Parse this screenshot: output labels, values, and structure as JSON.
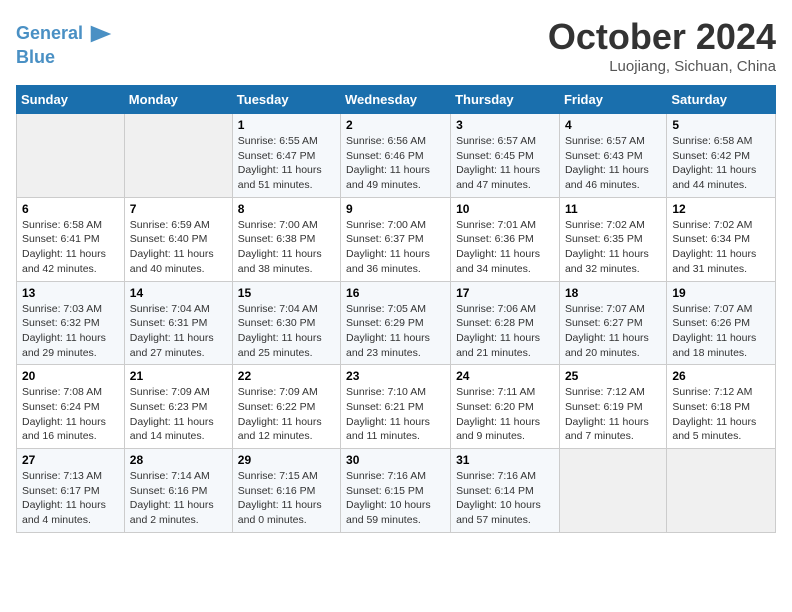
{
  "header": {
    "logo_line1": "General",
    "logo_line2": "Blue",
    "month_title": "October 2024",
    "subtitle": "Luojiang, Sichuan, China"
  },
  "days_of_week": [
    "Sunday",
    "Monday",
    "Tuesday",
    "Wednesday",
    "Thursday",
    "Friday",
    "Saturday"
  ],
  "weeks": [
    [
      {
        "day": "",
        "info": ""
      },
      {
        "day": "",
        "info": ""
      },
      {
        "day": "1",
        "info": "Sunrise: 6:55 AM\nSunset: 6:47 PM\nDaylight: 11 hours and 51 minutes."
      },
      {
        "day": "2",
        "info": "Sunrise: 6:56 AM\nSunset: 6:46 PM\nDaylight: 11 hours and 49 minutes."
      },
      {
        "day": "3",
        "info": "Sunrise: 6:57 AM\nSunset: 6:45 PM\nDaylight: 11 hours and 47 minutes."
      },
      {
        "day": "4",
        "info": "Sunrise: 6:57 AM\nSunset: 6:43 PM\nDaylight: 11 hours and 46 minutes."
      },
      {
        "day": "5",
        "info": "Sunrise: 6:58 AM\nSunset: 6:42 PM\nDaylight: 11 hours and 44 minutes."
      }
    ],
    [
      {
        "day": "6",
        "info": "Sunrise: 6:58 AM\nSunset: 6:41 PM\nDaylight: 11 hours and 42 minutes."
      },
      {
        "day": "7",
        "info": "Sunrise: 6:59 AM\nSunset: 6:40 PM\nDaylight: 11 hours and 40 minutes."
      },
      {
        "day": "8",
        "info": "Sunrise: 7:00 AM\nSunset: 6:38 PM\nDaylight: 11 hours and 38 minutes."
      },
      {
        "day": "9",
        "info": "Sunrise: 7:00 AM\nSunset: 6:37 PM\nDaylight: 11 hours and 36 minutes."
      },
      {
        "day": "10",
        "info": "Sunrise: 7:01 AM\nSunset: 6:36 PM\nDaylight: 11 hours and 34 minutes."
      },
      {
        "day": "11",
        "info": "Sunrise: 7:02 AM\nSunset: 6:35 PM\nDaylight: 11 hours and 32 minutes."
      },
      {
        "day": "12",
        "info": "Sunrise: 7:02 AM\nSunset: 6:34 PM\nDaylight: 11 hours and 31 minutes."
      }
    ],
    [
      {
        "day": "13",
        "info": "Sunrise: 7:03 AM\nSunset: 6:32 PM\nDaylight: 11 hours and 29 minutes."
      },
      {
        "day": "14",
        "info": "Sunrise: 7:04 AM\nSunset: 6:31 PM\nDaylight: 11 hours and 27 minutes."
      },
      {
        "day": "15",
        "info": "Sunrise: 7:04 AM\nSunset: 6:30 PM\nDaylight: 11 hours and 25 minutes."
      },
      {
        "day": "16",
        "info": "Sunrise: 7:05 AM\nSunset: 6:29 PM\nDaylight: 11 hours and 23 minutes."
      },
      {
        "day": "17",
        "info": "Sunrise: 7:06 AM\nSunset: 6:28 PM\nDaylight: 11 hours and 21 minutes."
      },
      {
        "day": "18",
        "info": "Sunrise: 7:07 AM\nSunset: 6:27 PM\nDaylight: 11 hours and 20 minutes."
      },
      {
        "day": "19",
        "info": "Sunrise: 7:07 AM\nSunset: 6:26 PM\nDaylight: 11 hours and 18 minutes."
      }
    ],
    [
      {
        "day": "20",
        "info": "Sunrise: 7:08 AM\nSunset: 6:24 PM\nDaylight: 11 hours and 16 minutes."
      },
      {
        "day": "21",
        "info": "Sunrise: 7:09 AM\nSunset: 6:23 PM\nDaylight: 11 hours and 14 minutes."
      },
      {
        "day": "22",
        "info": "Sunrise: 7:09 AM\nSunset: 6:22 PM\nDaylight: 11 hours and 12 minutes."
      },
      {
        "day": "23",
        "info": "Sunrise: 7:10 AM\nSunset: 6:21 PM\nDaylight: 11 hours and 11 minutes."
      },
      {
        "day": "24",
        "info": "Sunrise: 7:11 AM\nSunset: 6:20 PM\nDaylight: 11 hours and 9 minutes."
      },
      {
        "day": "25",
        "info": "Sunrise: 7:12 AM\nSunset: 6:19 PM\nDaylight: 11 hours and 7 minutes."
      },
      {
        "day": "26",
        "info": "Sunrise: 7:12 AM\nSunset: 6:18 PM\nDaylight: 11 hours and 5 minutes."
      }
    ],
    [
      {
        "day": "27",
        "info": "Sunrise: 7:13 AM\nSunset: 6:17 PM\nDaylight: 11 hours and 4 minutes."
      },
      {
        "day": "28",
        "info": "Sunrise: 7:14 AM\nSunset: 6:16 PM\nDaylight: 11 hours and 2 minutes."
      },
      {
        "day": "29",
        "info": "Sunrise: 7:15 AM\nSunset: 6:16 PM\nDaylight: 11 hours and 0 minutes."
      },
      {
        "day": "30",
        "info": "Sunrise: 7:16 AM\nSunset: 6:15 PM\nDaylight: 10 hours and 59 minutes."
      },
      {
        "day": "31",
        "info": "Sunrise: 7:16 AM\nSunset: 6:14 PM\nDaylight: 10 hours and 57 minutes."
      },
      {
        "day": "",
        "info": ""
      },
      {
        "day": "",
        "info": ""
      }
    ]
  ]
}
